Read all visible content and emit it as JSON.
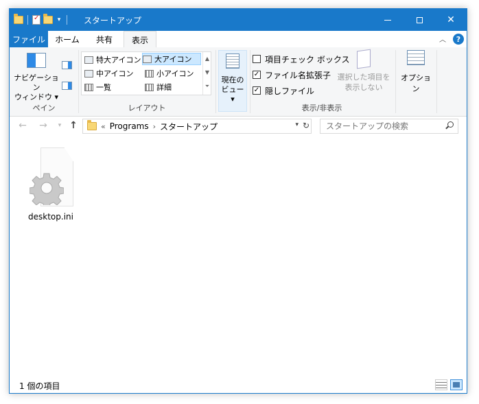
{
  "window": {
    "title": "スタートアップ",
    "accent_color": "#1979ca"
  },
  "quick_access": {
    "icons": [
      "folder-icon",
      "properties-icon",
      "new-folder-icon",
      "customize-dropdown-icon"
    ]
  },
  "ribbon_tabs": {
    "file": "ファイル",
    "home": "ホーム",
    "share": "共有",
    "view": "表示"
  },
  "ribbon": {
    "pane": {
      "nav_pane_label_line1": "ナビゲーション",
      "nav_pane_label_line2": "ウィンドウ",
      "group_label": "ペイン"
    },
    "layout": {
      "items": [
        "特大アイコン",
        "大アイコン",
        "中アイコン",
        "小アイコン",
        "一覧",
        "詳細"
      ],
      "selected": "大アイコン",
      "group_label": "レイアウト"
    },
    "current_view": {
      "label_line1": "現在の",
      "label_line2": "ビュー"
    },
    "show_hide": {
      "item_checkboxes": {
        "label": "項目チェック ボックス",
        "checked": false
      },
      "file_extensions": {
        "label": "ファイル名拡張子",
        "checked": true
      },
      "hidden_items": {
        "label": "隠しファイル",
        "checked": true
      },
      "hide_selected_line1": "選択した項目を",
      "hide_selected_line2": "表示しない",
      "group_label": "表示/非表示"
    },
    "options": {
      "label": "オプション"
    }
  },
  "address_bar": {
    "overflow": "«",
    "crumbs": [
      "Programs",
      "スタートアップ"
    ]
  },
  "search": {
    "placeholder": "スタートアップの検索"
  },
  "files": [
    {
      "name": "desktop.ini",
      "icon": "settings-file-icon"
    }
  ],
  "status_bar": {
    "item_count": "1 個の項目"
  }
}
